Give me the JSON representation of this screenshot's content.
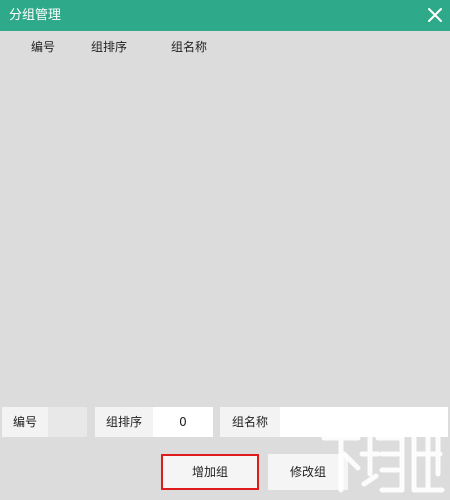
{
  "window": {
    "title": "分组管理",
    "close_icon": "close-icon",
    "accent_color": "#2ea98a"
  },
  "list": {
    "columns": [
      "编号",
      "组排序",
      "组名称"
    ],
    "rows": []
  },
  "form": {
    "id_label": "编号",
    "id_value": "",
    "order_label": "组排序",
    "order_value": "0",
    "name_label": "组名称",
    "name_value": ""
  },
  "buttons": {
    "add_label": "增加组",
    "edit_label": "修改组"
  },
  "watermark": {
    "text": "下载吧"
  }
}
